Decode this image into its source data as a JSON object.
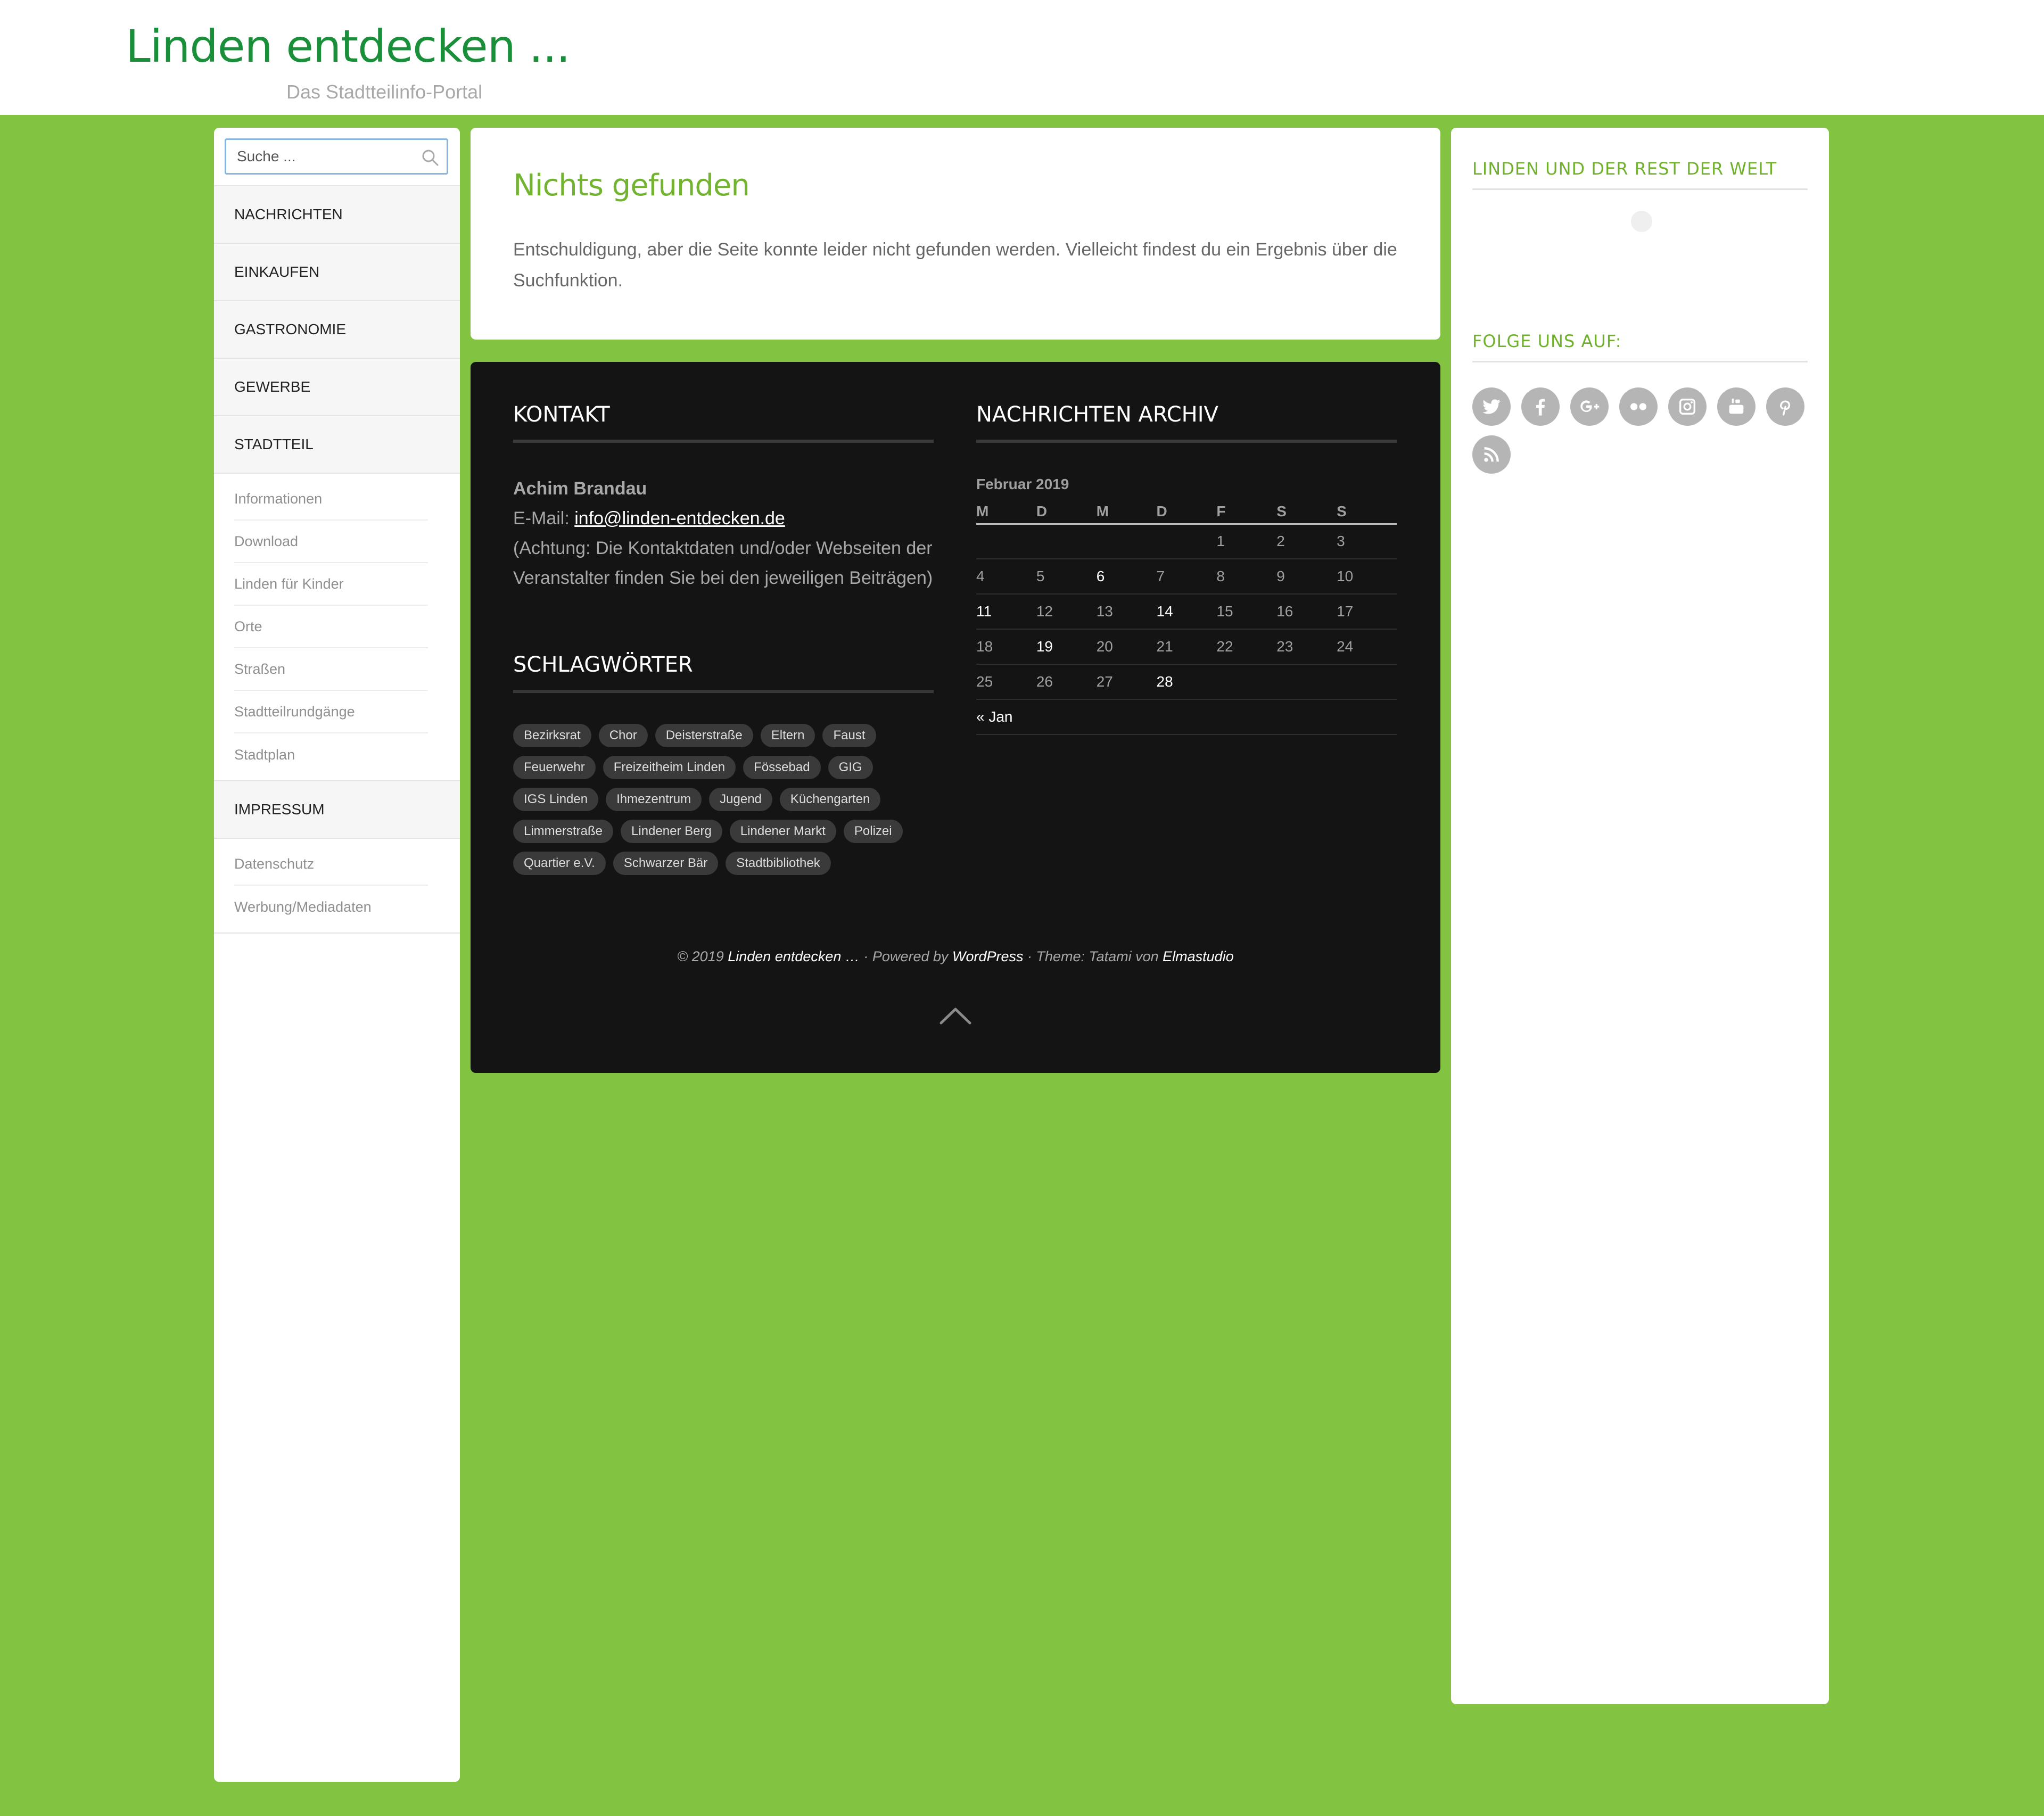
{
  "header": {
    "site_title": "Linden entdecken ...",
    "site_description": "Das Stadtteilinfo-Portal"
  },
  "search": {
    "placeholder": "Suche ..."
  },
  "nav": {
    "main1": [
      "NACHRICHTEN",
      "EINKAUFEN",
      "GASTRONOMIE",
      "GEWERBE",
      "STADTTEIL"
    ],
    "stadtteil_sub": [
      "Informationen",
      "Download",
      "Linden für Kinder",
      "Orte",
      "Straßen",
      "Stadtteilrundgänge",
      "Stadtplan"
    ],
    "main2": "IMPRESSUM",
    "impressum_sub": [
      "Datenschutz",
      "Werbung/Mediadaten"
    ]
  },
  "content": {
    "title": "Nichts gefunden",
    "text": "Entschuldigung, aber die Seite konnte leider nicht gefunden werden. Vielleicht findest du ein Ergebnis über die Suchfunktion."
  },
  "footer": {
    "contact_title": "KONTAKT",
    "contact_name": "Achim Brandau",
    "contact_email_label": "E-Mail: ",
    "contact_email": "info@linden-entdecken.de",
    "contact_note": "(Achtung: Die Kontaktdaten und/oder Webseiten der Veranstalter finden Sie bei den jeweiligen Beiträgen)",
    "tags_title": "SCHLAGWÖRTER",
    "tags": [
      "Bezirksrat",
      "Chor",
      "Deisterstraße",
      "Eltern",
      "Faust",
      "Feuerwehr",
      "Freizeitheim Linden",
      "Fössebad",
      "GIG",
      "IGS Linden",
      "Ihmezentrum",
      "Jugend",
      "Küchengarten",
      "Limmerstraße",
      "Lindener Berg",
      "Lindener Markt",
      "Polizei",
      "Quartier e.V.",
      "Schwarzer Bär",
      "Stadtbibliothek"
    ],
    "archive_title": "NACHRICHTEN ARCHIV",
    "calendar": {
      "caption": "Februar 2019",
      "weekdays": [
        "M",
        "D",
        "M",
        "D",
        "F",
        "S",
        "S"
      ],
      "weeks": [
        [
          "",
          "",
          "",
          "",
          "1",
          "2",
          "3"
        ],
        [
          "4",
          "5",
          "6",
          "7",
          "8",
          "9",
          "10"
        ],
        [
          "11",
          "12",
          "13",
          "14",
          "15",
          "16",
          "17"
        ],
        [
          "18",
          "19",
          "20",
          "21",
          "22",
          "23",
          "24"
        ],
        [
          "25",
          "26",
          "27",
          "28",
          "",
          "",
          ""
        ]
      ],
      "linked_days": [
        "6",
        "11",
        "14",
        "19",
        "28"
      ],
      "prev_label": "« Jan"
    },
    "credits": {
      "copyright": "© 2019 ",
      "site": "Linden entdecken …",
      "powered": " · Powered by ",
      "wordpress": "WordPress",
      "theme": " · Theme: Tatami von ",
      "elmastudio": "Elmastudio"
    }
  },
  "sidebar_right": {
    "widget1_title": "LINDEN UND DER REST DER WELT",
    "widget2_title": "FOLGE UNS AUF:",
    "social_icons": [
      "twitter-icon",
      "facebook-icon",
      "google-plus-icon",
      "flickr-icon",
      "instagram-icon",
      "youtube-icon",
      "pinterest-icon",
      "rss-icon"
    ]
  },
  "colors": {
    "background": "#82c341",
    "site_title": "#1a8f3a",
    "accent": "#72b42f",
    "footer_bg": "#141414"
  }
}
